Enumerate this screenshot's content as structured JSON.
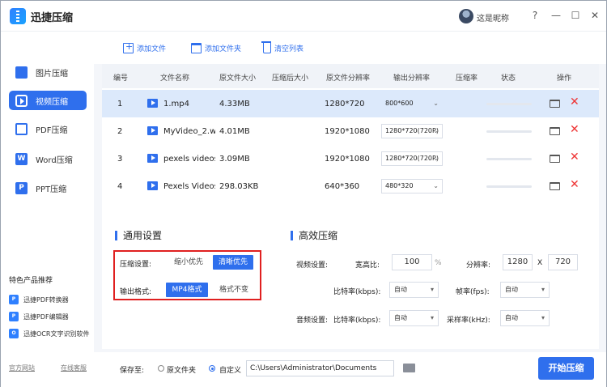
{
  "app": {
    "title": "迅捷压缩",
    "nickname": "这是昵称"
  },
  "window": {
    "help": "?",
    "minimize": "—",
    "maximize": "☐",
    "close": "✕"
  },
  "sidebar": {
    "items": [
      {
        "label": "图片压缩",
        "icon": "image-icon"
      },
      {
        "label": "视频压缩",
        "icon": "video-icon",
        "active": true
      },
      {
        "label": "PDF压缩",
        "icon": "pdf-icon"
      },
      {
        "label": "Word压缩",
        "icon": "word-icon"
      },
      {
        "label": "PPT压缩",
        "icon": "ppt-icon"
      }
    ],
    "featured_title": "特色产品推荐",
    "featured": [
      "迅捷PDF转换器",
      "迅捷PDF编辑器",
      "迅捷OCR文字识别软件"
    ],
    "links": {
      "website": "官方网站",
      "support": "在线客服"
    }
  },
  "toolbar": {
    "add_file": "添加文件",
    "add_folder": "添加文件夹",
    "clear_list": "清空列表"
  },
  "table": {
    "headers": [
      "编号",
      "文件名称",
      "原文件大小",
      "压缩后大小",
      "原文件分辨率",
      "输出分辨率",
      "压缩率",
      "状态",
      "操作"
    ],
    "rows": [
      {
        "no": "1",
        "name": "1.mp4",
        "size": "4.33MB",
        "res": "1280*720",
        "out": "800*600"
      },
      {
        "no": "2",
        "name": "MyVideo_2.w...",
        "size": "4.01MB",
        "res": "1920*1080",
        "out": "1280*720(720P)"
      },
      {
        "no": "3",
        "name": "pexels videos...",
        "size": "3.09MB",
        "res": "1920*1080",
        "out": "1280*720(720P)"
      },
      {
        "no": "4",
        "name": "Pexels Videos...",
        "size": "298.03KB",
        "res": "640*360",
        "out": "480*320"
      }
    ]
  },
  "general": {
    "title": "通用设置",
    "compress_label": "压缩设置:",
    "compress_opts": [
      "缩小优先",
      "清晰优先"
    ],
    "format_label": "输出格式:",
    "format_opts": [
      "MP4格式",
      "格式不变"
    ]
  },
  "advanced": {
    "title": "高效压缩",
    "video_label": "视频设置:",
    "aspect_label": "宽高比:",
    "aspect_value": "100",
    "percent": "%",
    "res_label": "分辨率:",
    "res_w": "1280",
    "x": "X",
    "res_h": "720",
    "bitrate_label": "比特率(kbps):",
    "bitrate_value": "自动",
    "fps_label": "帧率(fps):",
    "fps_value": "自动",
    "audio_label": "音频设置:",
    "audio_bitrate_label": "比特率(kbps):",
    "audio_bitrate_value": "自动",
    "sample_label": "采样率(kHz):",
    "sample_value": "自动"
  },
  "footer": {
    "save_label": "保存至:",
    "orig_folder": "原文件夹",
    "custom": "自定义",
    "path": "C:\\Users\\Administrator\\Documents",
    "start": "开始压缩"
  }
}
